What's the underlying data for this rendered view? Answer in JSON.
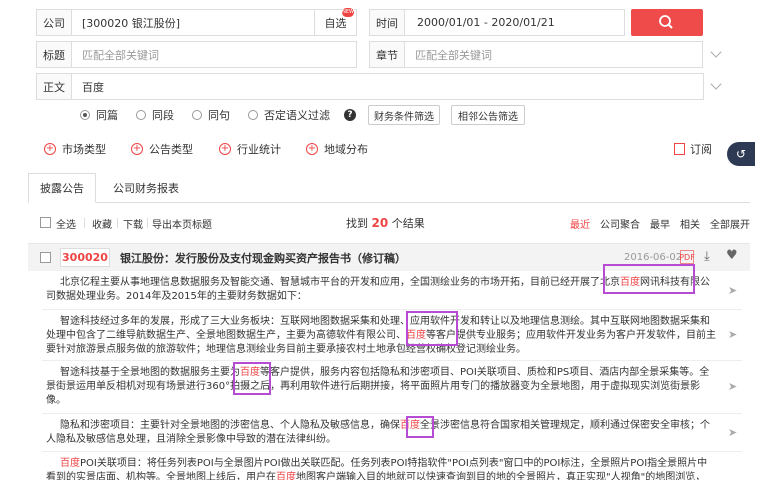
{
  "search": {
    "company_label": "公司",
    "company_value": "[300020 银江股份]",
    "zixuan_label": "自选",
    "new_badge": "NEW",
    "time_label": "时间",
    "time_value": "2000/01/01 - 2020/01/21",
    "title_label": "标题",
    "title_placeholder": "匹配全部关键词",
    "chapter_label": "章节",
    "chapter_placeholder": "匹配全部关键词",
    "body_label": "正文",
    "body_value": "百度"
  },
  "options": {
    "radios": [
      "同篇",
      "同段",
      "同句",
      "否定语义过滤"
    ],
    "selected": 0,
    "financial_filter": "财务条件筛选",
    "adjacent_filter": "相邻公告筛选"
  },
  "filters": [
    "市场类型",
    "公告类型",
    "行业统计",
    "地域分布"
  ],
  "subscribe_label": "订阅",
  "tabs": [
    "披露公告",
    "公司财务报表"
  ],
  "toolbar": {
    "select_all": "全选",
    "collect": "收藏",
    "download": "下载",
    "export": "导出本页标题",
    "result_prefix": "找到",
    "result_count": "20",
    "result_suffix": "个结果",
    "sorts": [
      "最近",
      "公司聚合",
      "最早",
      "相关",
      "全部展开"
    ]
  },
  "record": {
    "code": "300020",
    "title": "银江股份：发行股份及支付现金购买资产报告书（修订稿）",
    "date": "2016-06-02",
    "pdf_label": "PDF"
  },
  "paragraphs": [
    "北京亿程主要从事地理信息数据服务及智能交通、智慧城市平台的开发和应用，全国测绘业务的市场开拓，目前已经开展了北京百度网讯科技有限公司数据处理业务。2014年及2015年的主要财务数据如下：",
    "智途科技经过多年的发展，形成了三大业务板块：互联网地图数据采集和处理、应用软件开发和转让以及地理信息测绘。其中互联网地图数据采集和处理中包含了二维导航数据生产、全景地图数据生产，主要为高德软件有限公司、百度等客户提供专业服务；应用软件开发业务为客户开发软件，目前主要针对旅游景点服务做的旅游软件；地理信息测绘业务目前主要承接农村土地承包经营权确权登记测绘业务。",
    "智途科技基于全景地图的数据服务主要为百度等客户提供，服务内容包括隐私和涉密项目、POI关联项目、质检和PS项目、酒店内部全景采集等。全景街景运用单反相机对现有场景进行360°拍摄之后，再利用软件进行后期拼接，将平面照片用专门的播放器变为全景地图，用于虚拟现实浏览街景影像。",
    "隐私和涉密项目：主要针对全景地图的涉密信息、个人隐私及敏感信息，确保百度全景涉密信息符合国家相关管理规定，顺利通过保密安全审核；个人隐私及敏感信息处理，且消除全景影像中导致的潜在法律纠纷。",
    "百度POI关联项目：将任务列表POI与全景图片POI做出关联匹配。任务列表POI特指软件\"POI点列表\"窗口中的POI标注，全景照片POI指全景照片中看到的实景店面、机构等。全景地图上线后，用户在百度地图客户端输入目的地就可以快速查询到目的地的全景照片，真正实现\"人视角\"的地图浏览，"
  ],
  "highlight_term": "百度",
  "colors": {
    "accent": "#f04b4b",
    "highlight_box": "#b84bd4",
    "fab": "#2e3a54"
  }
}
